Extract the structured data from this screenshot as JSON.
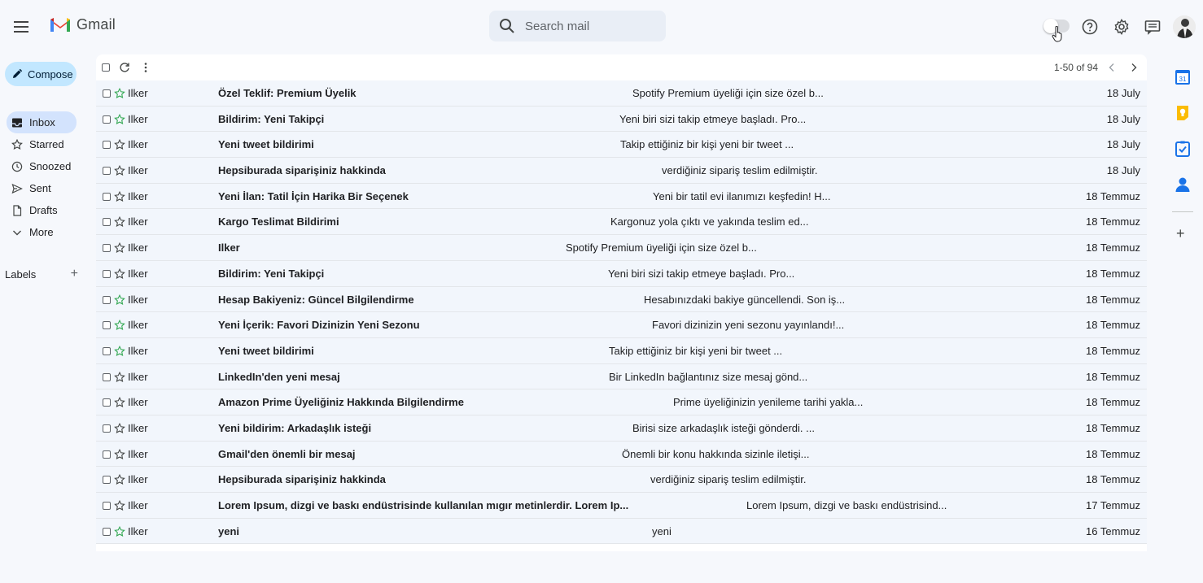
{
  "app": {
    "name": "Gmail"
  },
  "search": {
    "placeholder": "Search mail"
  },
  "sidebar": {
    "compose_label": "Compose",
    "items": [
      {
        "label": "Inbox",
        "icon": "inbox-icon",
        "active": true
      },
      {
        "label": "Starred",
        "icon": "star-icon"
      },
      {
        "label": "Snoozed",
        "icon": "clock-icon"
      },
      {
        "label": "Sent",
        "icon": "send-icon"
      },
      {
        "label": "Drafts",
        "icon": "draft-icon"
      },
      {
        "label": "More",
        "icon": "chevron-down-icon"
      }
    ],
    "labels_title": "Labels"
  },
  "toolbar": {
    "pagination": "1-50 of 94"
  },
  "emails": [
    {
      "sender": "Ilker",
      "subject": "Özel Teklif: Premium Üyelik",
      "snippet": "Spotify Premium üyeliği için size özel b...",
      "date": "18 July",
      "star": "green"
    },
    {
      "sender": "Ilker",
      "subject": "Bildirim: Yeni Takipçi",
      "snippet": "Yeni biri sizi takip etmeye başladı. Pro...",
      "date": "18 July",
      "star": "green"
    },
    {
      "sender": "Ilker",
      "subject": "Yeni tweet bildirimi",
      "snippet": "Takip ettiğiniz bir kişi yeni bir tweet ...",
      "date": "18 July",
      "star": "grey"
    },
    {
      "sender": "Ilker",
      "subject": "Hepsiburada siparişiniz hakkinda",
      "snippet": "verdiğiniz sipariş teslim edilmiştir.",
      "date": "18 July",
      "star": "grey"
    },
    {
      "sender": "Ilker",
      "subject": "Yeni İlan: Tatil İçin Harika Bir Seçenek",
      "snippet": "Yeni bir tatil evi ilanımızı keşfedin! H...",
      "date": "18 Temmuz",
      "star": "grey"
    },
    {
      "sender": "Ilker",
      "subject": "Kargo Teslimat Bildirimi",
      "snippet": "Kargonuz yola çıktı ve yakında teslim ed...",
      "date": "18 Temmuz",
      "star": "grey"
    },
    {
      "sender": "Ilker",
      "subject": "Ilker",
      "snippet": "Spotify Premium üyeliği için size özel b...",
      "date": "18 Temmuz",
      "star": "grey"
    },
    {
      "sender": "Ilker",
      "subject": "Bildirim: Yeni Takipçi",
      "snippet": "Yeni biri sizi takip etmeye başladı. Pro...",
      "date": "18 Temmuz",
      "star": "grey"
    },
    {
      "sender": "Ilker",
      "subject": "Hesap Bakiyeniz: Güncel Bilgilendirme",
      "snippet": "Hesabınızdaki bakiye güncellendi. Son iş...",
      "date": "18 Temmuz",
      "star": "green"
    },
    {
      "sender": "Ilker",
      "subject": "Yeni İçerik: Favori Dizinizin Yeni Sezonu",
      "snippet": "Favori dizinizin yeni sezonu yayınlandı!...",
      "date": "18 Temmuz",
      "star": "green"
    },
    {
      "sender": "Ilker",
      "subject": "Yeni tweet bildirimi",
      "snippet": "Takip ettiğiniz bir kişi yeni bir tweet ...",
      "date": "18 Temmuz",
      "star": "green"
    },
    {
      "sender": "Ilker",
      "subject": "LinkedIn'den yeni mesaj",
      "snippet": "Bir LinkedIn bağlantınız size mesaj gönd...",
      "date": "18 Temmuz",
      "star": "grey"
    },
    {
      "sender": "Ilker",
      "subject": "Amazon Prime Üyeliğiniz Hakkında Bilgilendirme",
      "snippet": "Prime üyeliğinizin yenileme tarihi yakla...",
      "date": "18 Temmuz",
      "star": "grey"
    },
    {
      "sender": "Ilker",
      "subject": "Yeni bildirim: Arkadaşlık isteği",
      "snippet": "Birisi size arkadaşlık isteği gönderdi. ...",
      "date": "18 Temmuz",
      "star": "grey"
    },
    {
      "sender": "Ilker",
      "subject": "Gmail'den önemli bir mesaj",
      "snippet": "Önemli bir konu hakkında sizinle iletişi...",
      "date": "18 Temmuz",
      "star": "grey"
    },
    {
      "sender": "Ilker",
      "subject": "Hepsiburada siparişiniz hakkinda",
      "snippet": "verdiğiniz sipariş teslim edilmiştir.",
      "date": "18 Temmuz",
      "star": "grey"
    },
    {
      "sender": "Ilker",
      "subject": "Lorem Ipsum, dizgi ve baskı endüstrisinde kullanılan mıgır metinlerdir. Lorem Ip...",
      "snippet": "Lorem Ipsum, dizgi ve baskı endüstrisind...",
      "date": "17 Temmuz",
      "star": "grey"
    },
    {
      "sender": "Ilker",
      "subject": "yeni",
      "snippet": "yeni",
      "date": "16 Temmuz",
      "star": "green"
    }
  ],
  "colors": {
    "accent": "#c2e7ff",
    "active_nav": "#d3e3fd",
    "star_green": "#34a853",
    "star_grey": "#444746"
  },
  "right_rail": [
    "calendar-icon",
    "keep-icon",
    "tasks-icon",
    "contacts-icon"
  ]
}
